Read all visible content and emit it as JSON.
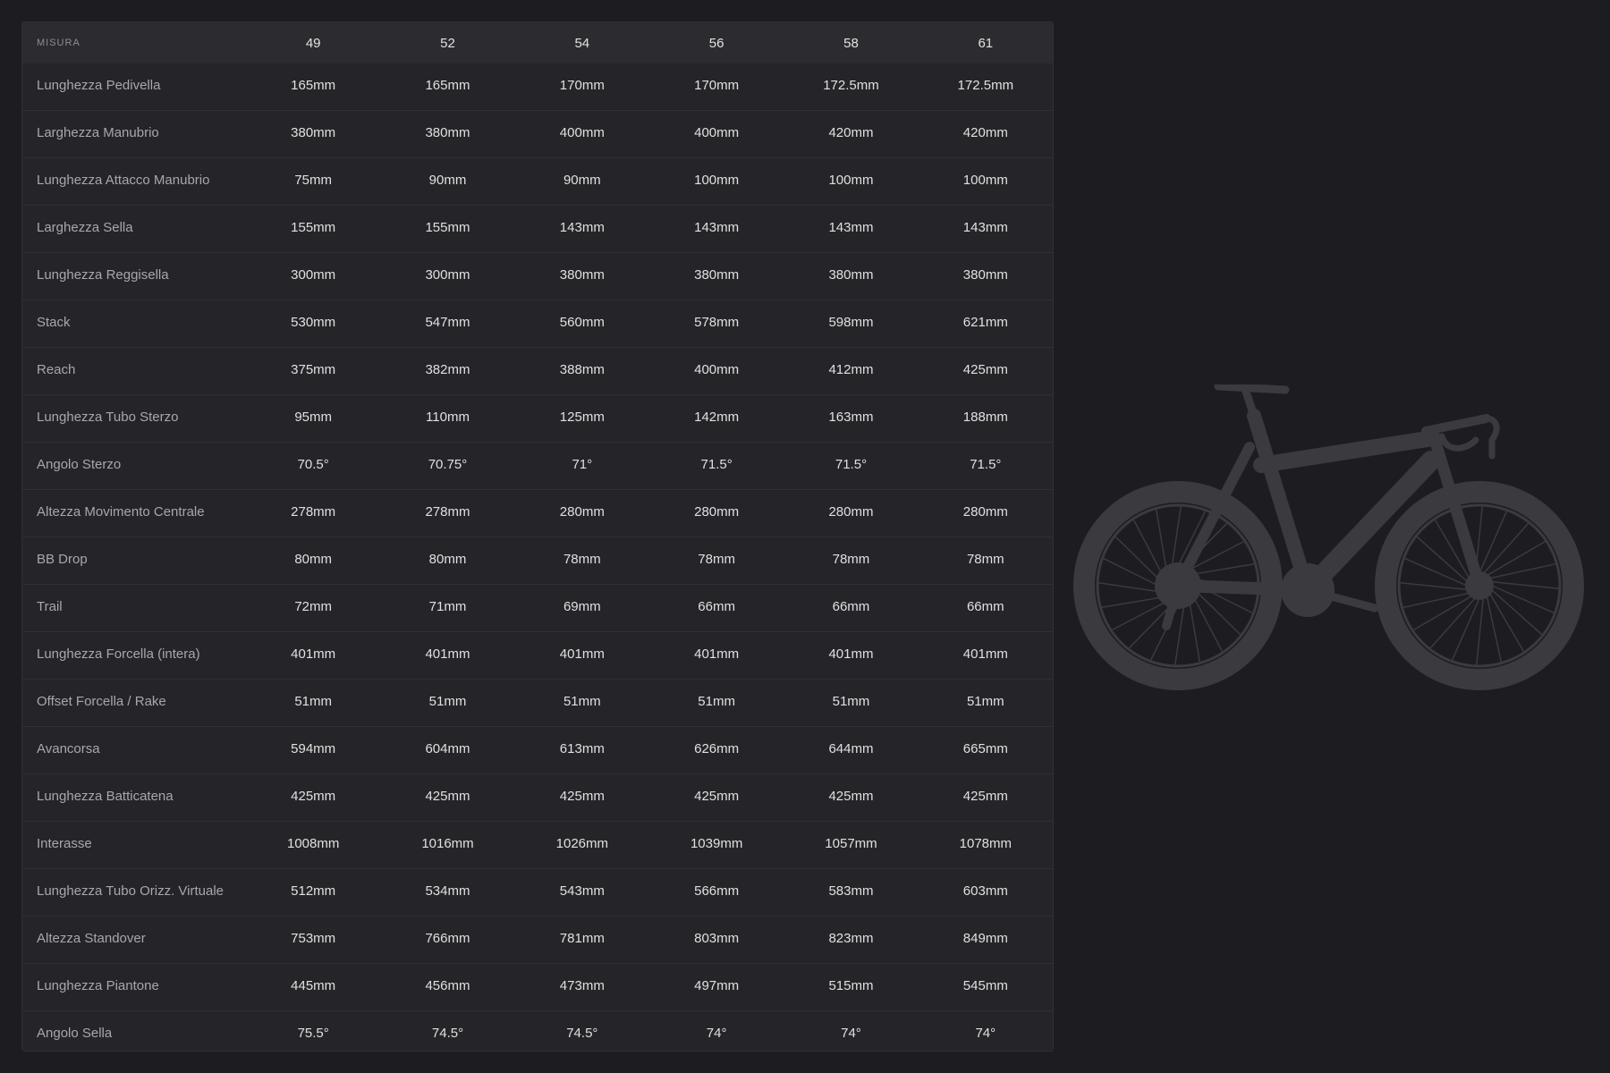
{
  "table": {
    "header_label": "MISURA",
    "sizes": [
      "49",
      "52",
      "54",
      "56",
      "58",
      "61"
    ],
    "rows": [
      {
        "label": "Lunghezza Pedivella",
        "values": [
          "165mm",
          "165mm",
          "170mm",
          "170mm",
          "172.5mm",
          "172.5mm"
        ]
      },
      {
        "label": "Larghezza Manubrio",
        "values": [
          "380mm",
          "380mm",
          "400mm",
          "400mm",
          "420mm",
          "420mm"
        ]
      },
      {
        "label": "Lunghezza Attacco Manubrio",
        "values": [
          "75mm",
          "90mm",
          "90mm",
          "100mm",
          "100mm",
          "100mm"
        ]
      },
      {
        "label": "Larghezza Sella",
        "values": [
          "155mm",
          "155mm",
          "143mm",
          "143mm",
          "143mm",
          "143mm"
        ]
      },
      {
        "label": "Lunghezza Reggisella",
        "values": [
          "300mm",
          "300mm",
          "380mm",
          "380mm",
          "380mm",
          "380mm"
        ]
      },
      {
        "label": "Stack",
        "values": [
          "530mm",
          "547mm",
          "560mm",
          "578mm",
          "598mm",
          "621mm"
        ]
      },
      {
        "label": "Reach",
        "values": [
          "375mm",
          "382mm",
          "388mm",
          "400mm",
          "412mm",
          "425mm"
        ]
      },
      {
        "label": "Lunghezza Tubo Sterzo",
        "values": [
          "95mm",
          "110mm",
          "125mm",
          "142mm",
          "163mm",
          "188mm"
        ]
      },
      {
        "label": "Angolo Sterzo",
        "values": [
          "70.5°",
          "70.75°",
          "71°",
          "71.5°",
          "71.5°",
          "71.5°"
        ]
      },
      {
        "label": "Altezza Movimento Centrale",
        "values": [
          "278mm",
          "278mm",
          "280mm",
          "280mm",
          "280mm",
          "280mm"
        ]
      },
      {
        "label": "BB Drop",
        "values": [
          "80mm",
          "80mm",
          "78mm",
          "78mm",
          "78mm",
          "78mm"
        ]
      },
      {
        "label": "Trail",
        "values": [
          "72mm",
          "71mm",
          "69mm",
          "66mm",
          "66mm",
          "66mm"
        ]
      },
      {
        "label": "Lunghezza Forcella (intera)",
        "values": [
          "401mm",
          "401mm",
          "401mm",
          "401mm",
          "401mm",
          "401mm"
        ]
      },
      {
        "label": "Offset Forcella / Rake",
        "values": [
          "51mm",
          "51mm",
          "51mm",
          "51mm",
          "51mm",
          "51mm"
        ]
      },
      {
        "label": "Avancorsa",
        "values": [
          "594mm",
          "604mm",
          "613mm",
          "626mm",
          "644mm",
          "665mm"
        ]
      },
      {
        "label": "Lunghezza Batticatena",
        "values": [
          "425mm",
          "425mm",
          "425mm",
          "425mm",
          "425mm",
          "425mm"
        ]
      },
      {
        "label": "Interasse",
        "values": [
          "1008mm",
          "1016mm",
          "1026mm",
          "1039mm",
          "1057mm",
          "1078mm"
        ]
      },
      {
        "label": "Lunghezza Tubo Orizz. Virtuale",
        "values": [
          "512mm",
          "534mm",
          "543mm",
          "566mm",
          "583mm",
          "603mm"
        ]
      },
      {
        "label": "Altezza Standover",
        "values": [
          "753mm",
          "766mm",
          "781mm",
          "803mm",
          "823mm",
          "849mm"
        ]
      },
      {
        "label": "Lunghezza Piantone",
        "values": [
          "445mm",
          "456mm",
          "473mm",
          "497mm",
          "515mm",
          "545mm"
        ]
      },
      {
        "label": "Angolo Sella",
        "values": [
          "75.5°",
          "74.5°",
          "74.5°",
          "74°",
          "74°",
          "74°"
        ]
      }
    ]
  },
  "illustration": {
    "name": "bike-silhouette",
    "color": "#3b3b3f"
  },
  "colors": {
    "page_background": "#1d1d21",
    "panel_background": "#252529",
    "header_background": "#2c2c30",
    "row_label_text": "#a7a7ac",
    "value_text": "#e0e0e0"
  }
}
